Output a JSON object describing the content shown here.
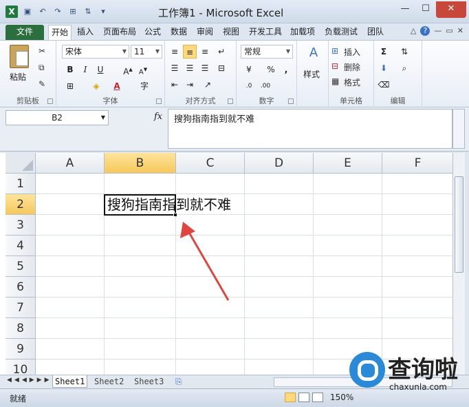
{
  "app": {
    "title": "工作簿1 - Microsoft Excel",
    "icon_letter": "X"
  },
  "tabs": [
    {
      "label": "文件"
    },
    {
      "label": "开始"
    },
    {
      "label": "插入"
    },
    {
      "label": "页面布局"
    },
    {
      "label": "公式"
    },
    {
      "label": "数据"
    },
    {
      "label": "审阅"
    },
    {
      "label": "视图"
    },
    {
      "label": "开发工具"
    },
    {
      "label": "加载项"
    },
    {
      "label": "负载测试"
    },
    {
      "label": "团队"
    }
  ],
  "ribbon": {
    "clipboard": {
      "label": "剪贴板",
      "paste": "粘贴"
    },
    "font": {
      "label": "字体",
      "name": "宋体",
      "size": "11",
      "bold": "B",
      "italic": "I",
      "underline": "U"
    },
    "alignment": {
      "label": "对齐方式"
    },
    "number": {
      "label": "数字",
      "format": "常规",
      "percent": "%",
      "comma": ","
    },
    "styles": {
      "label": "样式"
    },
    "cells": {
      "label": "单元格",
      "insert": "插入",
      "delete": "删除",
      "format": "格式"
    },
    "editing": {
      "label": "编辑"
    }
  },
  "formula_bar": {
    "name_box": "B2",
    "fx": "fx",
    "content": "搜狗指南指到就不难"
  },
  "grid": {
    "columns": [
      "A",
      "B",
      "C",
      "D",
      "E",
      "F"
    ],
    "rows": [
      "1",
      "2",
      "3",
      "4",
      "5",
      "6",
      "7",
      "8",
      "9",
      "10"
    ],
    "selected_cell": "B2",
    "cell_b2": "搜狗指南指到就不难"
  },
  "sheets": [
    {
      "label": "Sheet1",
      "active": true
    },
    {
      "label": "Sheet2",
      "active": false
    },
    {
      "label": "Sheet3",
      "active": false
    }
  ],
  "status": {
    "mode": "就绪",
    "zoom": "150%"
  },
  "watermark": {
    "text": "查询啦",
    "url": "chaxunla.com"
  },
  "colors": {
    "accent_selected": "#f7c85b",
    "file_tab": "#2c6f3f",
    "annotation_arrow": "#e0463f"
  }
}
